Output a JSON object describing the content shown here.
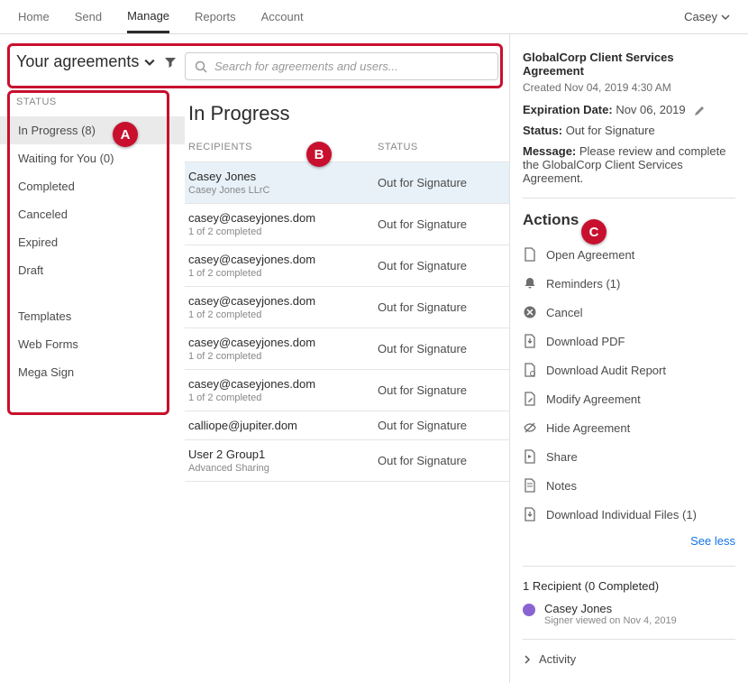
{
  "topnav": {
    "tabs": [
      "Home",
      "Send",
      "Manage",
      "Reports",
      "Account"
    ],
    "active_index": 2,
    "account_label": "Casey"
  },
  "sidebar": {
    "title": "Your agreements",
    "status_label": "STATUS",
    "statuses": [
      "In Progress (8)",
      "Waiting for You (0)",
      "Completed",
      "Canceled",
      "Expired",
      "Draft"
    ],
    "selected_status_index": 0,
    "other": [
      "Templates",
      "Web Forms",
      "Mega Sign"
    ]
  },
  "search": {
    "placeholder": "Search for agreements and users..."
  },
  "list": {
    "title": "In Progress",
    "col_recipients": "RECIPIENTS",
    "col_status": "STATUS",
    "rows": [
      {
        "name": "Casey Jones",
        "sub": "Casey Jones LLrC",
        "status": "Out for Signature",
        "selected": true
      },
      {
        "name": "casey@caseyjones.dom",
        "sub": "1 of 2 completed",
        "status": "Out for Signature"
      },
      {
        "name": "casey@caseyjones.dom",
        "sub": "1 of 2 completed",
        "status": "Out for Signature"
      },
      {
        "name": "casey@caseyjones.dom",
        "sub": "1 of 2 completed",
        "status": "Out for Signature"
      },
      {
        "name": "casey@caseyjones.dom",
        "sub": "1 of 2 completed",
        "status": "Out for Signature"
      },
      {
        "name": "casey@caseyjones.dom",
        "sub": "1 of 2 completed",
        "status": "Out for Signature"
      },
      {
        "name": "calliope@jupiter.dom",
        "sub": "",
        "status": "Out for Signature"
      },
      {
        "name": "User 2 Group1",
        "sub": "Advanced Sharing",
        "status": "Out for Signature"
      }
    ]
  },
  "detail": {
    "title": "GlobalCorp Client Services Agreement",
    "created": "Created Nov 04, 2019 4:30 AM",
    "exp_label": "Expiration Date:",
    "exp_value": "Nov 06, 2019",
    "status_label": "Status:",
    "status_value": "Out for Signature",
    "message_label": "Message:",
    "message_value": "Please review and complete the GlobalCorp Client Services Agreement.",
    "actions_title": "Actions",
    "actions": [
      "Open Agreement",
      "Reminders (1)",
      "Cancel",
      "Download PDF",
      "Download Audit Report",
      "Modify Agreement",
      "Hide Agreement",
      "Share",
      "Notes",
      "Download Individual Files (1)"
    ],
    "see_less": "See less",
    "recipients_summary": "1 Recipient (0 Completed)",
    "recipient_name": "Casey Jones",
    "recipient_sub": "Signer viewed on Nov 4, 2019",
    "activity_label": "Activity"
  },
  "annotations": {
    "A": "A",
    "B": "B",
    "C": "C"
  }
}
